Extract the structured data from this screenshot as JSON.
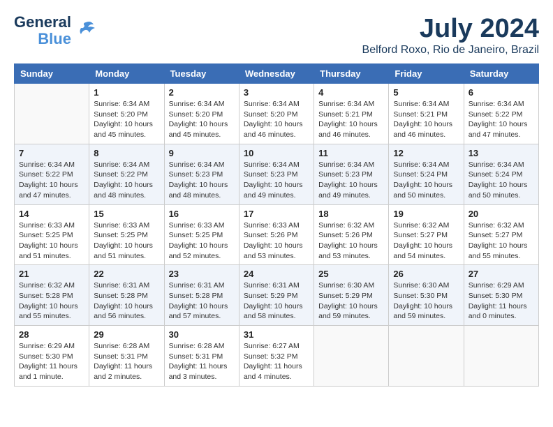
{
  "logo": {
    "line1": "General",
    "line2": "Blue"
  },
  "title": {
    "month_year": "July 2024",
    "location": "Belford Roxo, Rio de Janeiro, Brazil"
  },
  "days_of_week": [
    "Sunday",
    "Monday",
    "Tuesday",
    "Wednesday",
    "Thursday",
    "Friday",
    "Saturday"
  ],
  "weeks": [
    [
      {
        "day": "",
        "info": ""
      },
      {
        "day": "1",
        "info": "Sunrise: 6:34 AM\nSunset: 5:20 PM\nDaylight: 10 hours\nand 45 minutes."
      },
      {
        "day": "2",
        "info": "Sunrise: 6:34 AM\nSunset: 5:20 PM\nDaylight: 10 hours\nand 45 minutes."
      },
      {
        "day": "3",
        "info": "Sunrise: 6:34 AM\nSunset: 5:20 PM\nDaylight: 10 hours\nand 46 minutes."
      },
      {
        "day": "4",
        "info": "Sunrise: 6:34 AM\nSunset: 5:21 PM\nDaylight: 10 hours\nand 46 minutes."
      },
      {
        "day": "5",
        "info": "Sunrise: 6:34 AM\nSunset: 5:21 PM\nDaylight: 10 hours\nand 46 minutes."
      },
      {
        "day": "6",
        "info": "Sunrise: 6:34 AM\nSunset: 5:22 PM\nDaylight: 10 hours\nand 47 minutes."
      }
    ],
    [
      {
        "day": "7",
        "info": "Sunrise: 6:34 AM\nSunset: 5:22 PM\nDaylight: 10 hours\nand 47 minutes."
      },
      {
        "day": "8",
        "info": "Sunrise: 6:34 AM\nSunset: 5:22 PM\nDaylight: 10 hours\nand 48 minutes."
      },
      {
        "day": "9",
        "info": "Sunrise: 6:34 AM\nSunset: 5:23 PM\nDaylight: 10 hours\nand 48 minutes."
      },
      {
        "day": "10",
        "info": "Sunrise: 6:34 AM\nSunset: 5:23 PM\nDaylight: 10 hours\nand 49 minutes."
      },
      {
        "day": "11",
        "info": "Sunrise: 6:34 AM\nSunset: 5:23 PM\nDaylight: 10 hours\nand 49 minutes."
      },
      {
        "day": "12",
        "info": "Sunrise: 6:34 AM\nSunset: 5:24 PM\nDaylight: 10 hours\nand 50 minutes."
      },
      {
        "day": "13",
        "info": "Sunrise: 6:34 AM\nSunset: 5:24 PM\nDaylight: 10 hours\nand 50 minutes."
      }
    ],
    [
      {
        "day": "14",
        "info": "Sunrise: 6:33 AM\nSunset: 5:25 PM\nDaylight: 10 hours\nand 51 minutes."
      },
      {
        "day": "15",
        "info": "Sunrise: 6:33 AM\nSunset: 5:25 PM\nDaylight: 10 hours\nand 51 minutes."
      },
      {
        "day": "16",
        "info": "Sunrise: 6:33 AM\nSunset: 5:25 PM\nDaylight: 10 hours\nand 52 minutes."
      },
      {
        "day": "17",
        "info": "Sunrise: 6:33 AM\nSunset: 5:26 PM\nDaylight: 10 hours\nand 53 minutes."
      },
      {
        "day": "18",
        "info": "Sunrise: 6:32 AM\nSunset: 5:26 PM\nDaylight: 10 hours\nand 53 minutes."
      },
      {
        "day": "19",
        "info": "Sunrise: 6:32 AM\nSunset: 5:27 PM\nDaylight: 10 hours\nand 54 minutes."
      },
      {
        "day": "20",
        "info": "Sunrise: 6:32 AM\nSunset: 5:27 PM\nDaylight: 10 hours\nand 55 minutes."
      }
    ],
    [
      {
        "day": "21",
        "info": "Sunrise: 6:32 AM\nSunset: 5:28 PM\nDaylight: 10 hours\nand 55 minutes."
      },
      {
        "day": "22",
        "info": "Sunrise: 6:31 AM\nSunset: 5:28 PM\nDaylight: 10 hours\nand 56 minutes."
      },
      {
        "day": "23",
        "info": "Sunrise: 6:31 AM\nSunset: 5:28 PM\nDaylight: 10 hours\nand 57 minutes."
      },
      {
        "day": "24",
        "info": "Sunrise: 6:31 AM\nSunset: 5:29 PM\nDaylight: 10 hours\nand 58 minutes."
      },
      {
        "day": "25",
        "info": "Sunrise: 6:30 AM\nSunset: 5:29 PM\nDaylight: 10 hours\nand 59 minutes."
      },
      {
        "day": "26",
        "info": "Sunrise: 6:30 AM\nSunset: 5:30 PM\nDaylight: 10 hours\nand 59 minutes."
      },
      {
        "day": "27",
        "info": "Sunrise: 6:29 AM\nSunset: 5:30 PM\nDaylight: 11 hours\nand 0 minutes."
      }
    ],
    [
      {
        "day": "28",
        "info": "Sunrise: 6:29 AM\nSunset: 5:30 PM\nDaylight: 11 hours\nand 1 minute."
      },
      {
        "day": "29",
        "info": "Sunrise: 6:28 AM\nSunset: 5:31 PM\nDaylight: 11 hours\nand 2 minutes."
      },
      {
        "day": "30",
        "info": "Sunrise: 6:28 AM\nSunset: 5:31 PM\nDaylight: 11 hours\nand 3 minutes."
      },
      {
        "day": "31",
        "info": "Sunrise: 6:27 AM\nSunset: 5:32 PM\nDaylight: 11 hours\nand 4 minutes."
      },
      {
        "day": "",
        "info": ""
      },
      {
        "day": "",
        "info": ""
      },
      {
        "day": "",
        "info": ""
      }
    ]
  ]
}
